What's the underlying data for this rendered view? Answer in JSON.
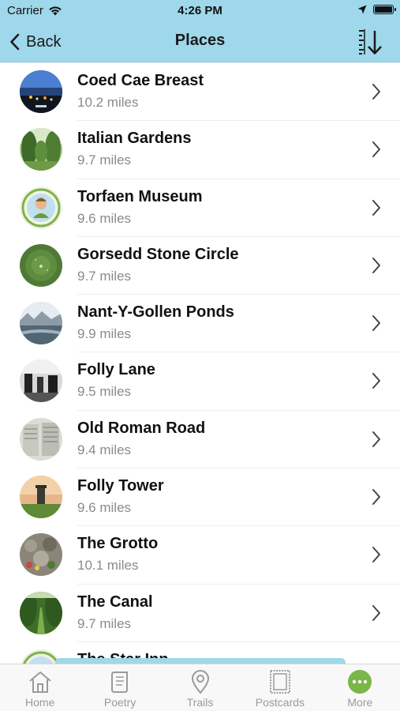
{
  "status": {
    "carrier": "Carrier",
    "time": "4:26 PM"
  },
  "nav": {
    "back_label": "Back",
    "title": "Places"
  },
  "places": [
    {
      "name": "Coed Cae Breast",
      "distance": "10.2 miles"
    },
    {
      "name": "Italian Gardens",
      "distance": "9.7 miles"
    },
    {
      "name": "Torfaen Museum",
      "distance": "9.6 miles"
    },
    {
      "name": "Gorsedd Stone Circle",
      "distance": "9.7 miles"
    },
    {
      "name": "Nant-Y-Gollen Ponds",
      "distance": "9.9 miles"
    },
    {
      "name": "Folly Lane",
      "distance": "9.5 miles"
    },
    {
      "name": "Old Roman Road",
      "distance": "9.4 miles"
    },
    {
      "name": "Folly Tower",
      "distance": "9.6 miles"
    },
    {
      "name": "The Grotto",
      "distance": "10.1 miles"
    },
    {
      "name": "The Canal",
      "distance": "9.7 miles"
    },
    {
      "name": "The Star Inn",
      "distance": ""
    }
  ],
  "tabs": [
    {
      "label": "Home",
      "icon": "house-icon"
    },
    {
      "label": "Poetry",
      "icon": "scroll-icon"
    },
    {
      "label": "Trails",
      "icon": "map-pin-icon"
    },
    {
      "label": "Postcards",
      "icon": "postcard-icon"
    },
    {
      "label": "More",
      "icon": "more-icon"
    }
  ],
  "colors": {
    "nav_background": "#9ed8ea",
    "more_tab_accent": "#7ab648",
    "tab_inactive": "#9a9a9a"
  }
}
